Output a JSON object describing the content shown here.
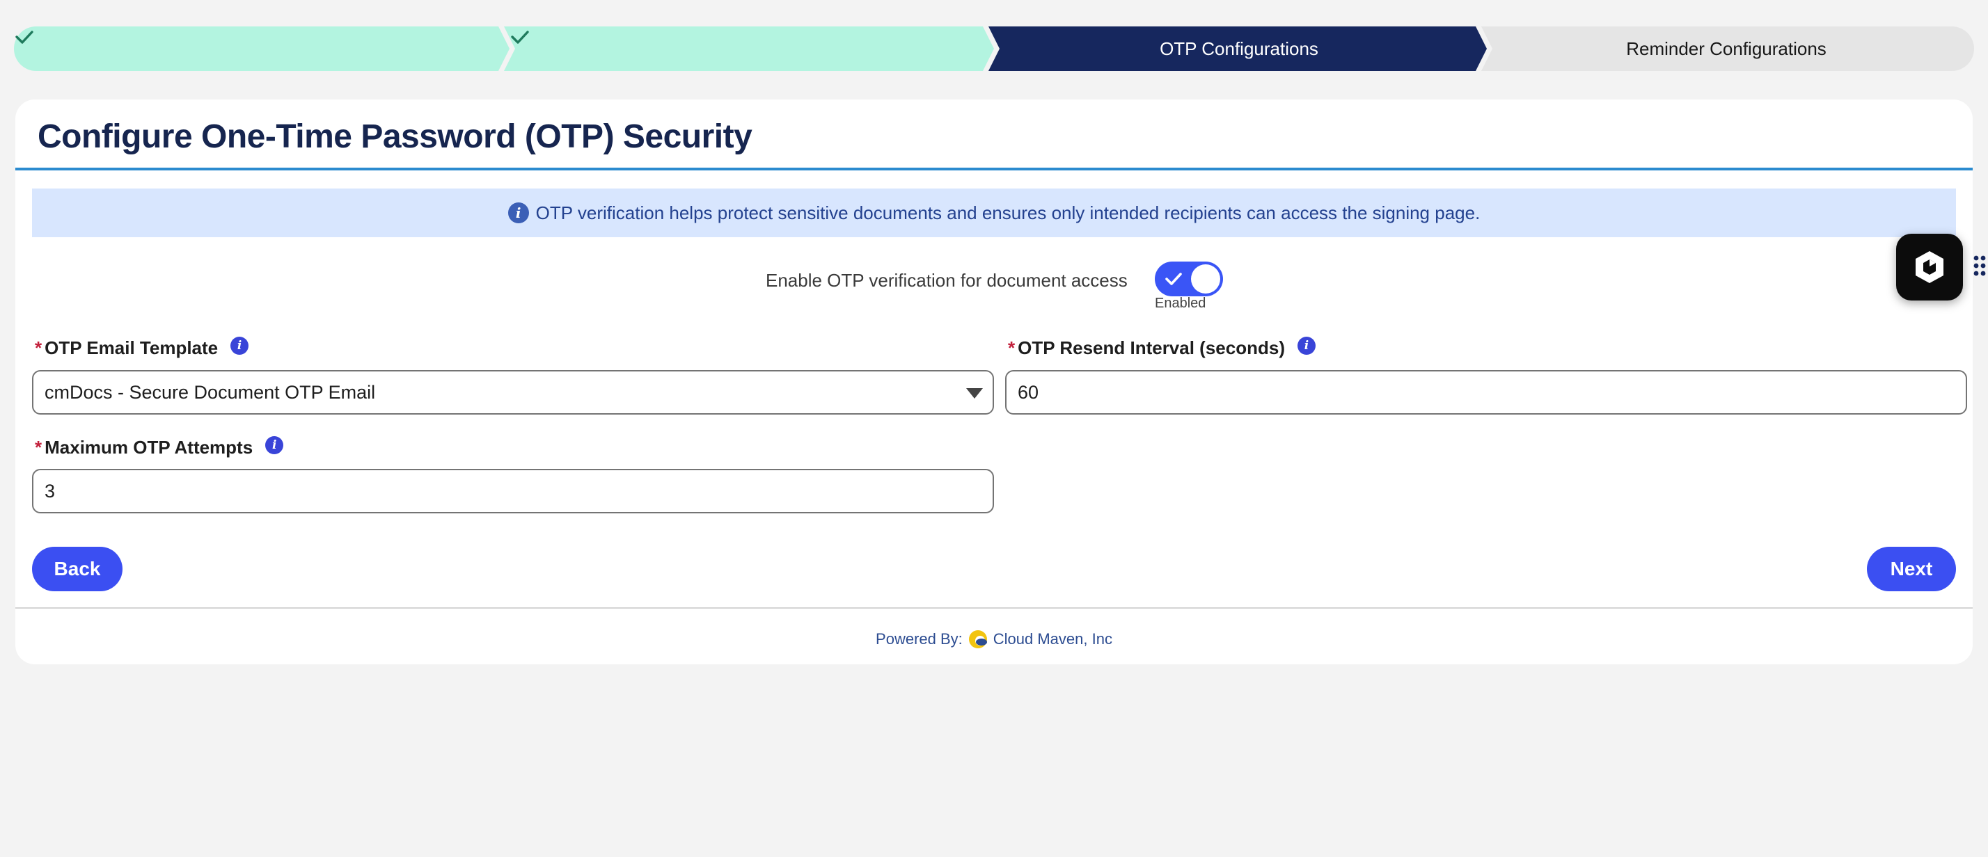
{
  "progress": {
    "stages": [
      {
        "label": "",
        "status": "complete"
      },
      {
        "label": "",
        "status": "complete"
      },
      {
        "label": "OTP Configurations",
        "status": "active"
      },
      {
        "label": "Reminder Configurations",
        "status": "upcoming"
      }
    ]
  },
  "card": {
    "title": "Configure One-Time Password (OTP) Security",
    "info_banner": "OTP verification helps protect sensitive documents and ensures only intended recipients can access the signing page."
  },
  "otp_toggle": {
    "label": "Enable OTP verification for document access",
    "state_text": "Enabled",
    "checked": true
  },
  "fields": {
    "email_template": {
      "label": "OTP Email Template",
      "required_marker": "*",
      "value": "cmDocs - Secure Document OTP Email"
    },
    "resend_interval": {
      "label": "OTP Resend Interval (seconds)",
      "required_marker": "*",
      "value": "60"
    },
    "max_attempts": {
      "label": "Maximum OTP Attempts",
      "required_marker": "*",
      "value": "3"
    }
  },
  "buttons": {
    "back": "Back",
    "next": "Next"
  },
  "footer": {
    "powered_by": "Powered By:",
    "company": "Cloud Maven, Inc"
  },
  "colors": {
    "complete_stage": "#b3f4e0",
    "active_stage": "#16275e",
    "upcoming_stage": "#e5e5e5",
    "brand_button": "#3b4ff2",
    "info_banner_bg": "#d8e6fe"
  },
  "icons": {
    "complete_stage": "check-icon",
    "info": "info-icon",
    "help": "help-icon",
    "dropdown": "chevron-down-icon",
    "fab": "agent-hexagon-icon",
    "drag": "drag-handle-icon",
    "footer_logo": "cloud-maven-logo"
  }
}
